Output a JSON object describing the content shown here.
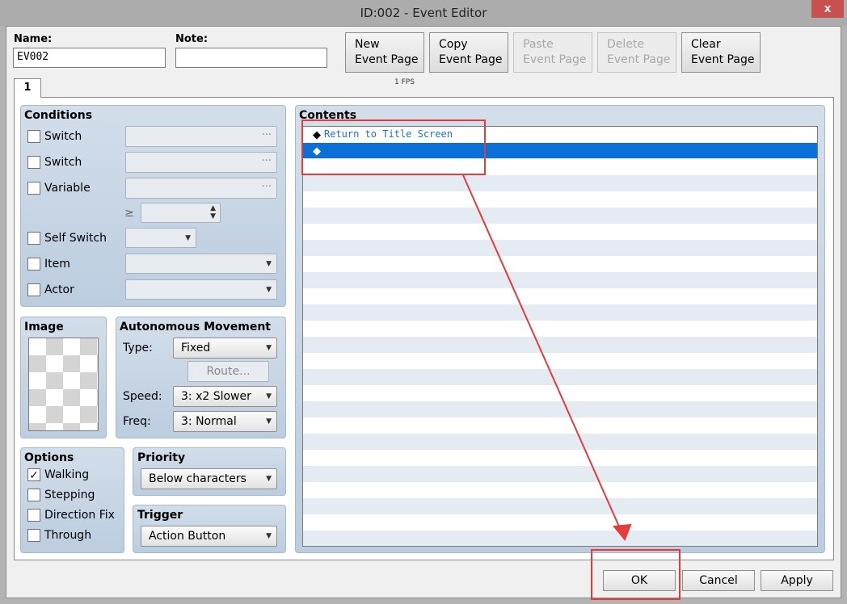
{
  "window": {
    "title": "ID:002 - Event Editor",
    "close_glyph": "x"
  },
  "header": {
    "name_label": "Name:",
    "name_value": "EV002",
    "note_label": "Note:",
    "note_value": "",
    "buttons": [
      {
        "line1": "New",
        "line2": "Event Page",
        "enabled": true
      },
      {
        "line1": "Copy",
        "line2": "Event Page",
        "enabled": true
      },
      {
        "line1": "Paste",
        "line2": "Event Page",
        "enabled": false
      },
      {
        "line1": "Delete",
        "line2": "Event Page",
        "enabled": false
      },
      {
        "line1": "Clear",
        "line2": "Event Page",
        "enabled": true
      }
    ],
    "fps": "1 FPS"
  },
  "tabs": [
    "1"
  ],
  "conditions": {
    "title": "Conditions",
    "switch1": "Switch",
    "switch2": "Switch",
    "variable": "Variable",
    "ellipsis": "···",
    "gte": "≥",
    "self_switch": "Self Switch",
    "item": "Item",
    "actor": "Actor"
  },
  "image": {
    "title": "Image"
  },
  "movement": {
    "title": "Autonomous Movement",
    "type_label": "Type:",
    "type_value": "Fixed",
    "route_label": "Route...",
    "speed_label": "Speed:",
    "speed_value": "3: x2 Slower",
    "freq_label": "Freq:",
    "freq_value": "3: Normal"
  },
  "options": {
    "title": "Options",
    "walking": "Walking",
    "walking_checked": true,
    "stepping": "Stepping",
    "direction_fix": "Direction Fix",
    "through": "Through",
    "check_glyph": "✓"
  },
  "priority": {
    "title": "Priority",
    "value": "Below characters"
  },
  "trigger": {
    "title": "Trigger",
    "value": "Action Button"
  },
  "contents": {
    "title": "Contents",
    "rows": [
      {
        "marker": "◆",
        "text": "Return to Title Screen",
        "selected": false
      },
      {
        "marker": "◆",
        "text": "",
        "selected": true
      }
    ]
  },
  "dialog": {
    "ok": "OK",
    "cancel": "Cancel",
    "apply": "Apply"
  },
  "annotation": {
    "color": "#e53b3b"
  },
  "colors": {
    "selection": "#0a6fd6",
    "group_bg": "#c7d5e5",
    "command_text": "#1e73c8"
  }
}
